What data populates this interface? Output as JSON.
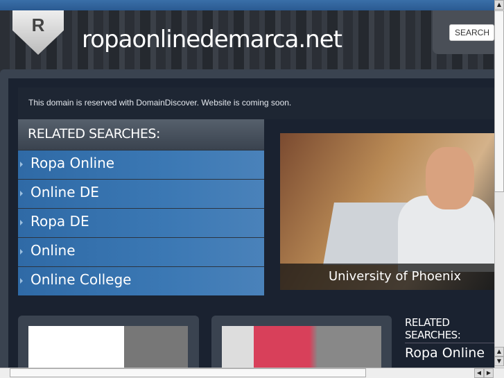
{
  "header": {
    "logo_letter": "R",
    "site_title": "ropaonlinedemarca.net",
    "search_label": "SEARCH"
  },
  "notice": "This domain is reserved with DomainDiscover. Website is coming soon.",
  "related": {
    "title": "RELATED SEARCHES:",
    "items": [
      {
        "label": "Ropa Online"
      },
      {
        "label": "Online DE"
      },
      {
        "label": "Ropa DE"
      },
      {
        "label": "Online"
      },
      {
        "label": "Online College"
      }
    ]
  },
  "feature": {
    "caption": "University of Phoenix"
  },
  "related2": {
    "title": "RELATED SEARCHES:",
    "first_item": "Ropa Online"
  },
  "colors": {
    "accent": "#3270ac",
    "background": "#1c2430"
  }
}
